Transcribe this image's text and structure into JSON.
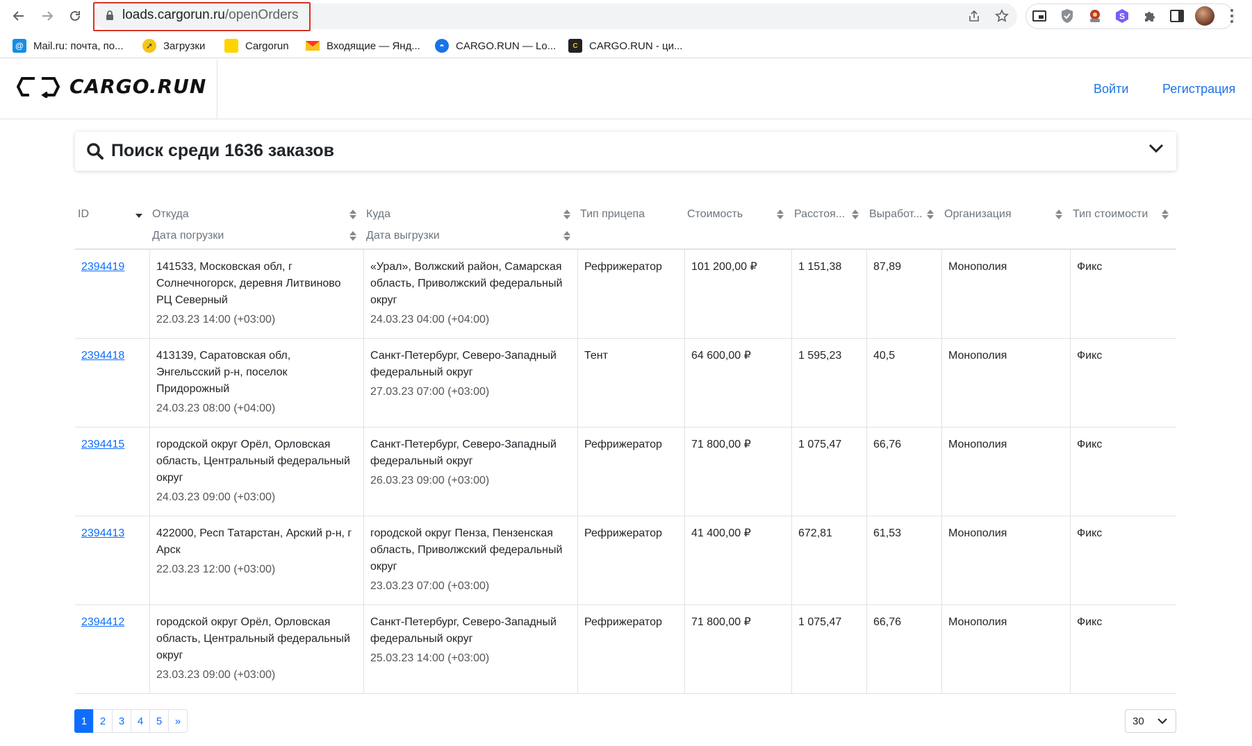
{
  "browser": {
    "url_host": "loads.cargorun.ru",
    "url_path": "/openOrders",
    "bookmarks": [
      {
        "label": "Mail.ru: почта, по...",
        "icon": "mailru-icon",
        "color": "#168de2"
      },
      {
        "label": "Загрузки",
        "icon": "compass-icon",
        "color": "#f5c518"
      },
      {
        "label": "Cargorun",
        "icon": "cargorun-folder-icon",
        "color": "#ffd400"
      },
      {
        "label": "Входящие — Янд...",
        "icon": "yandex-mail-icon",
        "color": "#f33"
      },
      {
        "label": "CARGO.RUN — Lo...",
        "icon": "cargorun-globe-icon",
        "color": "#1a73e8"
      },
      {
        "label": "CARGO.RUN - ци...",
        "icon": "cargorun-logo-icon",
        "color": "#222"
      }
    ]
  },
  "header": {
    "logo_text": "CARGO.RUN",
    "login_label": "Войти",
    "register_label": "Регистрация",
    "link_color": "#1a73e8"
  },
  "search": {
    "title": "Поиск среди 1636 заказов"
  },
  "table": {
    "columns": {
      "id": "ID",
      "from": "Откуда",
      "load_date": "Дата погрузки",
      "to": "Куда",
      "unload_date": "Дата выгрузки",
      "trailer": "Тип прицепа",
      "cost": "Стоимость",
      "distance": "Расстоя...",
      "output": "Выработ...",
      "org": "Организация",
      "cost_type": "Тип стоимости"
    },
    "rows": [
      {
        "id": "2394419",
        "from": "141533, Московская обл, г Солнечногорск, деревня Литвиново РЦ Северный",
        "load_date": "22.03.23 14:00 (+03:00)",
        "to": "«Урал», Волжский район, Самарская область, Приволжский федеральный округ",
        "unload_date": "24.03.23 04:00 (+04:00)",
        "trailer": "Рефрижератор",
        "cost": "101 200,00 ₽",
        "distance": "1 151,38",
        "output": "87,89",
        "org": "Монополия",
        "cost_type": "Фикс"
      },
      {
        "id": "2394418",
        "from": "413139, Саратовская обл, Энгельсский р-н, поселок Придорожный",
        "load_date": "24.03.23 08:00 (+04:00)",
        "to": "Санкт-Петербург, Северо-Западный федеральный округ",
        "unload_date": "27.03.23 07:00 (+03:00)",
        "trailer": "Тент",
        "cost": "64 600,00 ₽",
        "distance": "1 595,23",
        "output": "40,5",
        "org": "Монополия",
        "cost_type": "Фикс"
      },
      {
        "id": "2394415",
        "from": "городской округ Орёл, Орловская область, Центральный федеральный округ",
        "load_date": "24.03.23 09:00 (+03:00)",
        "to": "Санкт-Петербург, Северо-Западный федеральный округ",
        "unload_date": "26.03.23 09:00 (+03:00)",
        "trailer": "Рефрижератор",
        "cost": "71 800,00 ₽",
        "distance": "1 075,47",
        "output": "66,76",
        "org": "Монополия",
        "cost_type": "Фикс"
      },
      {
        "id": "2394413",
        "from": "422000, Респ Татарстан, Арский р-н, г Арск",
        "load_date": "22.03.23 12:00 (+03:00)",
        "to": "городской округ Пенза, Пензенская область, Приволжский федеральный округ",
        "unload_date": "23.03.23 07:00 (+03:00)",
        "trailer": "Рефрижератор",
        "cost": "41 400,00 ₽",
        "distance": "672,81",
        "output": "61,53",
        "org": "Монополия",
        "cost_type": "Фикс"
      },
      {
        "id": "2394412",
        "from": "городской округ Орёл, Орловская область, Центральный федеральный округ",
        "load_date": "23.03.23 09:00 (+03:00)",
        "to": "Санкт-Петербург, Северо-Западный федеральный округ",
        "unload_date": "25.03.23 14:00 (+03:00)",
        "trailer": "Рефрижератор",
        "cost": "71 800,00 ₽",
        "distance": "1 075,47",
        "output": "66,76",
        "org": "Монополия",
        "cost_type": "Фикс"
      }
    ]
  },
  "pagination": {
    "pages": [
      "1",
      "2",
      "3",
      "4",
      "5"
    ],
    "next_label": "»",
    "current_page": "1",
    "page_size": "30",
    "accent": "#0d6efd"
  }
}
